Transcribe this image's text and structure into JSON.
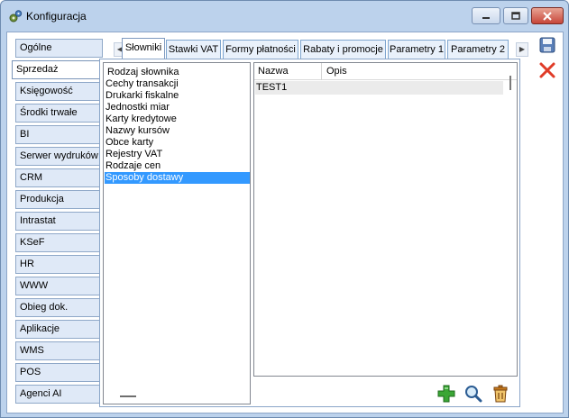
{
  "window": {
    "title": "Konfiguracja",
    "app_icon": "gears-icon",
    "controls": [
      "minimize-icon",
      "maximize-icon",
      "close-icon"
    ]
  },
  "sidebar": {
    "items": [
      {
        "label": "Ogólne",
        "active": false
      },
      {
        "label": "Sprzedaż",
        "active": true
      },
      {
        "label": "Księgowość",
        "active": false
      },
      {
        "label": "Środki trwałe",
        "active": false
      },
      {
        "label": "BI",
        "active": false
      },
      {
        "label": "Serwer wydruków",
        "active": false
      },
      {
        "label": "CRM",
        "active": false
      },
      {
        "label": "Produkcja",
        "active": false
      },
      {
        "label": "Intrastat",
        "active": false
      },
      {
        "label": "KSeF",
        "active": false
      },
      {
        "label": "HR",
        "active": false
      },
      {
        "label": "WWW",
        "active": false
      },
      {
        "label": "Obieg dok.",
        "active": false
      },
      {
        "label": "Aplikacje",
        "active": false
      },
      {
        "label": "WMS",
        "active": false
      },
      {
        "label": "POS",
        "active": false
      },
      {
        "label": "Agenci AI",
        "active": false
      }
    ]
  },
  "tabs": {
    "items": [
      {
        "label": "Słowniki",
        "active": true
      },
      {
        "label": "Stawki VAT",
        "active": false
      },
      {
        "label": "Formy płatności",
        "active": false
      },
      {
        "label": "Rabaty i promocje",
        "active": false
      },
      {
        "label": "Parametry 1",
        "active": false
      },
      {
        "label": "Parametry 2",
        "active": false
      }
    ]
  },
  "dictionary_list": {
    "header": "Rodzaj słownika",
    "items": [
      "Cechy transakcji",
      "Drukarki fiskalne",
      "Jednostki miar",
      "Karty kredytowe",
      "Nazwy kursów",
      "Obce karty",
      "Rejestry VAT",
      "Rodzaje cen",
      "Sposoby dostawy"
    ],
    "selected": "Sposoby dostawy"
  },
  "grid": {
    "columns": [
      "Nazwa",
      "Opis"
    ],
    "rows": [
      {
        "nazwa": "TEST1",
        "opis": ""
      }
    ]
  },
  "toolbar_right": {
    "save_icon": "save-icon",
    "cancel_icon": "cancel-icon"
  },
  "toolbar_bottom": {
    "add_icon": "add-icon",
    "search_icon": "search-icon",
    "delete_icon": "delete-icon"
  },
  "colors": {
    "frame": "#bcd2ec",
    "selection": "#3399ff",
    "add_green": "#3aa635",
    "delete_orange": "#c87a1e",
    "close_red": "#e03c28"
  }
}
